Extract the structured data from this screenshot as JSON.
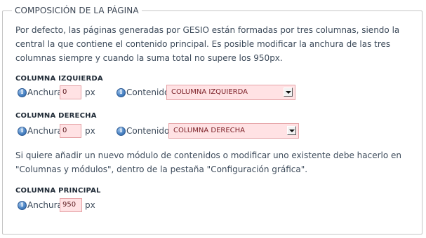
{
  "panel": {
    "legend": "COMPOSICIÓN DE LA PÁGINA",
    "description": "Por defecto, las páginas generadas por GESIO están formadas por tres columnas, siendo la central la que contiene el contenido principal. Es posible modificar la anchura de las tres columnas siempre y cuando la suma total no supere los 950px.",
    "note": "Si quiere añadir un nuevo módulo de contenidos o modificar uno existente debe hacerlo en \"Columnas y módulos\", dentro de la pestaña \"Configuración gráfica\"."
  },
  "left_column": {
    "title": "COLUMNA IZQUIERDA",
    "width_label": "Anchura",
    "width_value": "0",
    "unit": "px",
    "content_label": "Contenido",
    "content_selected": "COLUMNA IZQUIERDA"
  },
  "right_column": {
    "title": "COLUMNA DERECHA",
    "width_label": "Anchura",
    "width_value": "0",
    "unit": "px",
    "content_label": "Contenido",
    "content_selected": "COLUMNA DERECHA"
  },
  "main_column": {
    "title": "COLUMNA PRINCIPAL",
    "width_label": "Anchura",
    "width_value": "950",
    "unit": "px"
  },
  "icons": {
    "info": "info-icon"
  },
  "colors": {
    "input_background": "#ffe2e4",
    "input_border": "#e5a2a6",
    "info_icon": "#4d86c6",
    "fieldset_border": "#c4c4c4"
  }
}
